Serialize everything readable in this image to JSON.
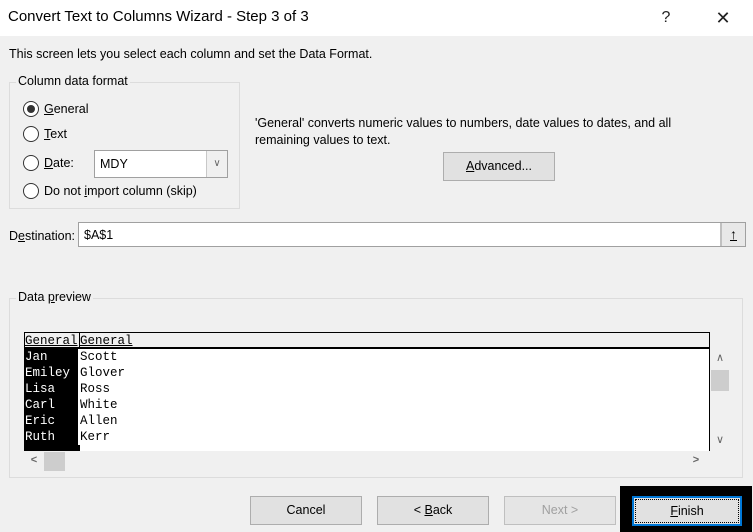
{
  "window": {
    "title": "Convert Text to Columns Wizard - Step 3 of 3",
    "help_icon": "?",
    "close_icon": "✕"
  },
  "intro": "This screen lets you select each column and set the Data Format.",
  "column_format": {
    "label": "Column data format",
    "options": [
      {
        "pre": "",
        "accel": "G",
        "post": "eneral",
        "selected": true
      },
      {
        "pre": "",
        "accel": "T",
        "post": "ext",
        "selected": false
      },
      {
        "pre": "",
        "accel": "D",
        "post": "ate:",
        "selected": false
      },
      {
        "pre": "Do not ",
        "accel": "i",
        "post": "mport column (skip)",
        "selected": false
      }
    ],
    "date_format": "MDY",
    "dropdown_icon": "∨"
  },
  "description": "'General' converts numeric values to numbers, date values to dates, and all remaining values to text.",
  "advanced": {
    "accel": "A",
    "rest": "dvanced..."
  },
  "destination": {
    "label_pre": "D",
    "label_accel": "e",
    "label_post": "stination:",
    "value": "$A$1",
    "collapse_icon": "↑"
  },
  "preview": {
    "label_pre": "Data ",
    "label_accel": "p",
    "label_post": "review",
    "headers": [
      "General",
      "General"
    ],
    "rows": [
      [
        "Jan",
        "Scott"
      ],
      [
        "Emiley",
        "Glover"
      ],
      [
        "Lisa",
        "Ross"
      ],
      [
        "Carl",
        "White"
      ],
      [
        "Eric",
        "Allen"
      ],
      [
        "Ruth",
        "Kerr"
      ]
    ],
    "scroll_up": "∧",
    "scroll_down": "∨",
    "scroll_left": "<",
    "scroll_right": ">"
  },
  "buttons": {
    "cancel": "Cancel",
    "back_pre": "< ",
    "back_accel": "B",
    "back_post": "ack",
    "next": "Next >",
    "finish_accel": "F",
    "finish_post": "inish"
  }
}
